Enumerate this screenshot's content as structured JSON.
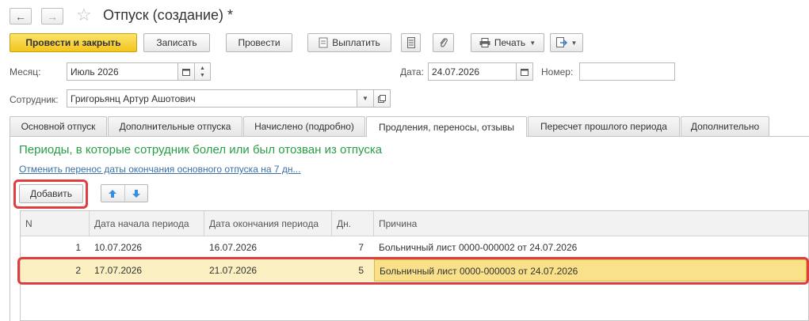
{
  "header": {
    "title": "Отпуск (создание) *",
    "back_icon": "←",
    "forward_icon": "→",
    "star_icon": "☆"
  },
  "toolbar": {
    "post_close_label": "Провести и закрыть",
    "save_label": "Записать",
    "post_label": "Провести",
    "pay_label": "Выплатить",
    "print_label": "Печать"
  },
  "form": {
    "month_label": "Месяц:",
    "month_value": "Июль 2026",
    "date_label": "Дата:",
    "date_value": "24.07.2026",
    "number_label": "Номер:",
    "number_value": "",
    "employee_label": "Сотрудник:",
    "employee_value": "Григорьянц Артур Ашотович"
  },
  "tabs": [
    {
      "label": "Основной отпуск",
      "active": false
    },
    {
      "label": "Дополнительные отпуска",
      "active": false
    },
    {
      "label": "Начислено (подробно)",
      "active": false
    },
    {
      "label": "Продления, переносы, отзывы",
      "active": true
    },
    {
      "label": "Пересчет прошлого периода",
      "active": false
    },
    {
      "label": "Дополнительно",
      "active": false
    }
  ],
  "section": {
    "title": "Периоды, в которые сотрудник болел или был отозван из отпуска",
    "link": "Отменить перенос даты окончания основного отпуска на 7 дн...",
    "add_label": "Добавить"
  },
  "table": {
    "columns": [
      "N",
      "Дата начала периода",
      "Дата окончания периода",
      "Дн.",
      "Причина"
    ],
    "rows": [
      {
        "n": "1",
        "start": "10.07.2026",
        "end": "16.07.2026",
        "days": "7",
        "reason": "Больничный лист 0000-000002 от 24.07.2026",
        "selected": false
      },
      {
        "n": "2",
        "start": "17.07.2026",
        "end": "21.07.2026",
        "days": "5",
        "reason": "Больничный лист 0000-000003 от 24.07.2026",
        "selected": true
      }
    ]
  },
  "colors": {
    "primary_button": "#f3c51e",
    "section_title": "#2a9d47",
    "link": "#3b6fa5",
    "highlight": "#e03e3e",
    "selected_row": "#fbf0c2"
  }
}
